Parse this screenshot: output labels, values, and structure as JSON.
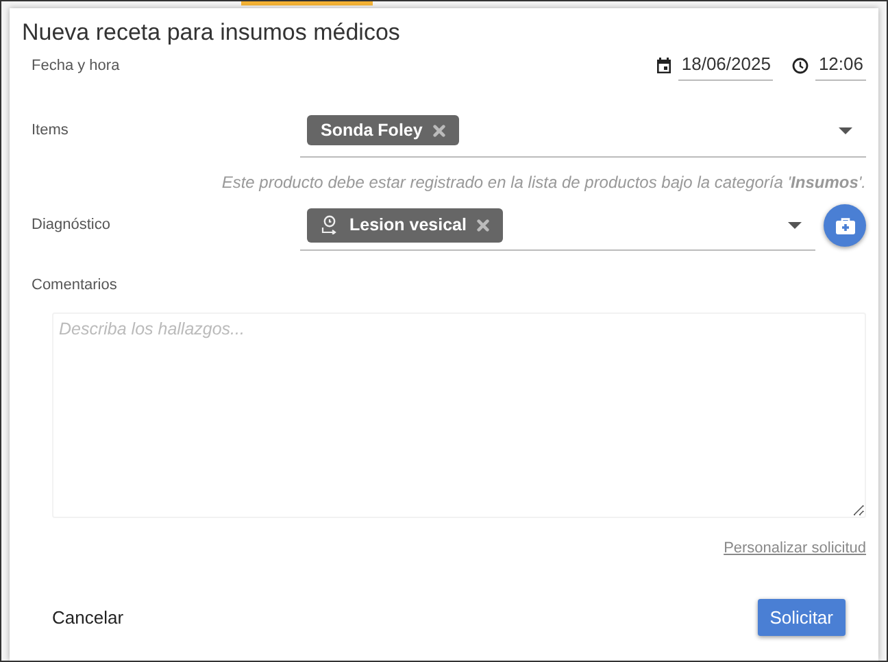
{
  "dialog": {
    "title": "Nueva receta para insumos médicos"
  },
  "datetime": {
    "label": "Fecha y hora",
    "date": "18/06/2025",
    "time": "12:06"
  },
  "items": {
    "label": "Items",
    "chips": [
      {
        "text": "Sonda Foley"
      }
    ],
    "hint": "Este producto debe estar registrado en la lista de productos bajo la categoría '**Insumos**'."
  },
  "diagnosis": {
    "label": "Diagnóstico",
    "chips": [
      {
        "text": "Lesion vesical"
      }
    ]
  },
  "comments": {
    "label": "Comentarios",
    "placeholder": "Describa los hallazgos..."
  },
  "customize_link": "Personalizar solicitud",
  "buttons": {
    "cancel": "Cancelar",
    "submit": "Solicitar"
  }
}
